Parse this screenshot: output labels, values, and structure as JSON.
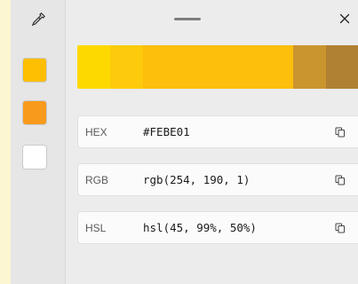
{
  "sidebar": {
    "picker_icon": "eyedropper-icon",
    "swatches": [
      {
        "color": "#FEBE01"
      },
      {
        "color": "#F89B1C"
      },
      {
        "color": "#FFFFFF"
      }
    ]
  },
  "titlebar": {
    "drag_icon": "drag-handle-icon",
    "close_icon": "close-icon"
  },
  "shades": [
    "#FDD900",
    "#FDCB0B",
    "#FDBE0C",
    "#CA952F",
    "#B08132"
  ],
  "formats": [
    {
      "label": "HEX",
      "value": "#FEBE01",
      "icon": "copy-icon"
    },
    {
      "label": "RGB",
      "value": "rgb(254, 190, 1)",
      "icon": "copy-icon"
    },
    {
      "label": "HSL",
      "value": "hsl(45, 99%, 50%)",
      "icon": "copy-icon"
    }
  ]
}
